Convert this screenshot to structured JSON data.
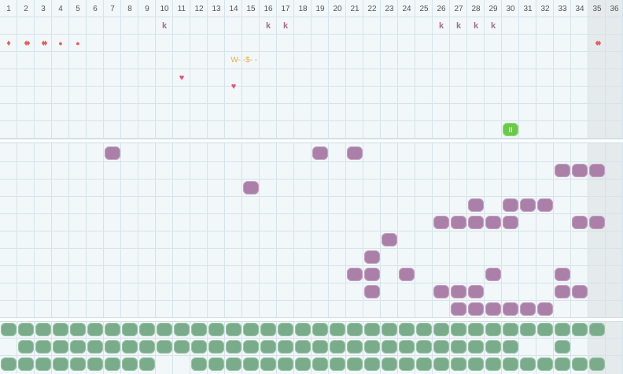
{
  "columns": [
    "1",
    "2",
    "3",
    "4",
    "5",
    "6",
    "7",
    "8",
    "9",
    "10",
    "11",
    "12",
    "13",
    "14",
    "15",
    "16",
    "17",
    "18",
    "19",
    "20",
    "21",
    "22",
    "23",
    "24",
    "25",
    "26",
    "27",
    "28",
    "29",
    "30",
    "31",
    "32",
    "33",
    "34",
    "35",
    "36"
  ],
  "colors": {
    "k": "#a0708f",
    "drop": "#e06060",
    "heart": "#e0557a",
    "purple": "#aa7fa8",
    "green": "#7aab8a",
    "bright": "#6cc84a",
    "ws": "#e8b040"
  },
  "top_marks": [
    {
      "col": 10,
      "row": 1,
      "text": "k",
      "icon": "k-glyph"
    },
    {
      "col": 16,
      "row": 1,
      "text": "k",
      "icon": "k-glyph"
    },
    {
      "col": 17,
      "row": 1,
      "text": "k",
      "icon": "k-glyph"
    },
    {
      "col": 26,
      "row": 1,
      "text": "k",
      "icon": "k-glyph"
    },
    {
      "col": 27,
      "row": 1,
      "text": "k",
      "icon": "k-glyph"
    },
    {
      "col": 28,
      "row": 1,
      "text": "k",
      "icon": "k-glyph"
    },
    {
      "col": 29,
      "row": 1,
      "text": "k",
      "icon": "k-glyph"
    },
    {
      "col": 1,
      "row": 2,
      "text": "♦",
      "icon": "drop-icon"
    },
    {
      "col": 2,
      "row": 2,
      "text": "♦♦",
      "icon": "drop-icon"
    },
    {
      "col": 3,
      "row": 2,
      "text": "♦♦",
      "icon": "drop-icon"
    },
    {
      "col": 4,
      "row": 2,
      "text": "●",
      "icon": "dot-icon"
    },
    {
      "col": 5,
      "row": 2,
      "text": "●",
      "icon": "dot-icon"
    },
    {
      "col": 35,
      "row": 2,
      "text": "♦♦",
      "icon": "drop-icon"
    },
    {
      "col": 11,
      "row": 4,
      "text": "♥",
      "icon": "heart-icon"
    },
    {
      "col": 14,
      "row": 4.5,
      "text": "♥",
      "icon": "heart-icon"
    }
  ],
  "ws_label": {
    "text": "W- -$- -",
    "col": 13.2,
    "row": 3
  },
  "bright_tile": {
    "col": 30,
    "row": 7,
    "text": "II"
  },
  "purple_tiles": [
    [
      7,
      9
    ],
    [
      19,
      9
    ],
    [
      21,
      9
    ],
    [
      33,
      10
    ],
    [
      34,
      10
    ],
    [
      35,
      10
    ],
    [
      15,
      11
    ],
    [
      28,
      12
    ],
    [
      30,
      12
    ],
    [
      31,
      12
    ],
    [
      32,
      12
    ],
    [
      26,
      13
    ],
    [
      27,
      13
    ],
    [
      28,
      13
    ],
    [
      29,
      13
    ],
    [
      30,
      13
    ],
    [
      34,
      13
    ],
    [
      35,
      13
    ],
    [
      23,
      14
    ],
    [
      22,
      15
    ],
    [
      21,
      16
    ],
    [
      22,
      16
    ],
    [
      24,
      16
    ],
    [
      29,
      16
    ],
    [
      33,
      16
    ],
    [
      22,
      17
    ],
    [
      26,
      17
    ],
    [
      27,
      17
    ],
    [
      28,
      17
    ],
    [
      33,
      17
    ],
    [
      34,
      17
    ],
    [
      27,
      18
    ],
    [
      28,
      18
    ],
    [
      29,
      18
    ],
    [
      30,
      18
    ],
    [
      31,
      18
    ],
    [
      32,
      18
    ]
  ],
  "green_rows": [
    {
      "row": 19,
      "cols": [
        1,
        2,
        3,
        4,
        5,
        6,
        7,
        8,
        9,
        10,
        11,
        12,
        13,
        14,
        15,
        16,
        17,
        18,
        19,
        20,
        21,
        22,
        23,
        24,
        25,
        26,
        27,
        28,
        29,
        30,
        31,
        32,
        33,
        34,
        35
      ]
    },
    {
      "row": 20,
      "cols": [
        2,
        3,
        4,
        5,
        6,
        7,
        8,
        9,
        10,
        11,
        12,
        13,
        14,
        15,
        16,
        17,
        18,
        19,
        20,
        21,
        22,
        23,
        24,
        25,
        26,
        27,
        28,
        29,
        30,
        33
      ]
    },
    {
      "row": 21,
      "cols": [
        1,
        2,
        3,
        4,
        5,
        6,
        7,
        8,
        9,
        12,
        13,
        14,
        15,
        16,
        17,
        18,
        19,
        20,
        21,
        22,
        23,
        24,
        25,
        26,
        27,
        28,
        29,
        30,
        31,
        32,
        33,
        34,
        35
      ]
    }
  ]
}
